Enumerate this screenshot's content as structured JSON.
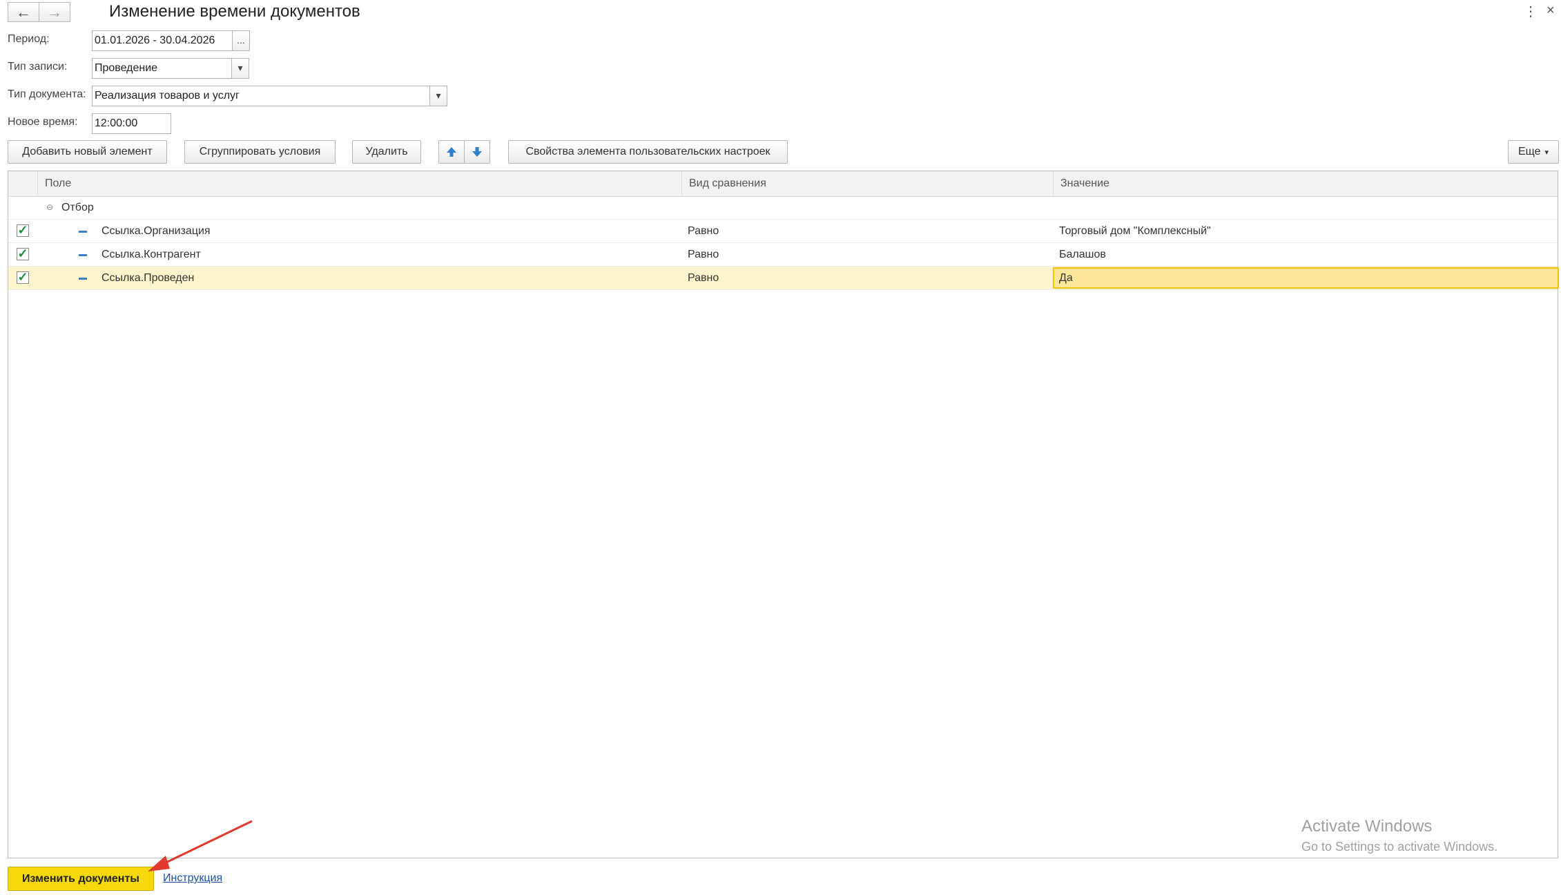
{
  "window": {
    "title": "Изменение времени документов",
    "back_icon": "←",
    "forward_icon": "→",
    "menu_icon": "⋮",
    "close_icon": "×"
  },
  "form": {
    "period_label": "Период:",
    "period_value": "01.01.2026 - 30.04.2026",
    "period_btn": "...",
    "record_type_label": "Тип записи:",
    "record_type_value": "Проведение",
    "doc_type_label": "Тип документа:",
    "doc_type_value": "Реализация товаров и услуг",
    "new_time_label": "Новое время:",
    "new_time_value": "12:00:00"
  },
  "toolbar": {
    "add_label": "Добавить новый элемент",
    "group_label": "Сгруппировать условия",
    "delete_label": "Удалить",
    "properties_label": "Свойства элемента пользовательских настроек",
    "more_label": "Еще"
  },
  "grid": {
    "columns": [
      "Поле",
      "Вид сравнения",
      "Значение"
    ],
    "group_label": "Отбор",
    "rows": [
      {
        "checked": true,
        "field": "Ссылка.Организация",
        "comparison": "Равно",
        "value": "Торговый дом \"Комплексный\""
      },
      {
        "checked": true,
        "field": "Ссылка.Контрагент",
        "comparison": "Равно",
        "value": "Балашов"
      },
      {
        "checked": true,
        "field": "Ссылка.Проведен",
        "comparison": "Равно",
        "value": "Да"
      }
    ]
  },
  "watermark": {
    "line1": "Activate Windows",
    "line2": "Go to Settings to activate Windows."
  },
  "footer": {
    "main_button": "Изменить документы",
    "instruction_link": "Инструкция"
  },
  "colors": {
    "accent_yellow": "#f5d90d",
    "selected_row": "#fff5cc",
    "check_green": "#1a8f3a",
    "arrow_red": "#e03a2f"
  }
}
